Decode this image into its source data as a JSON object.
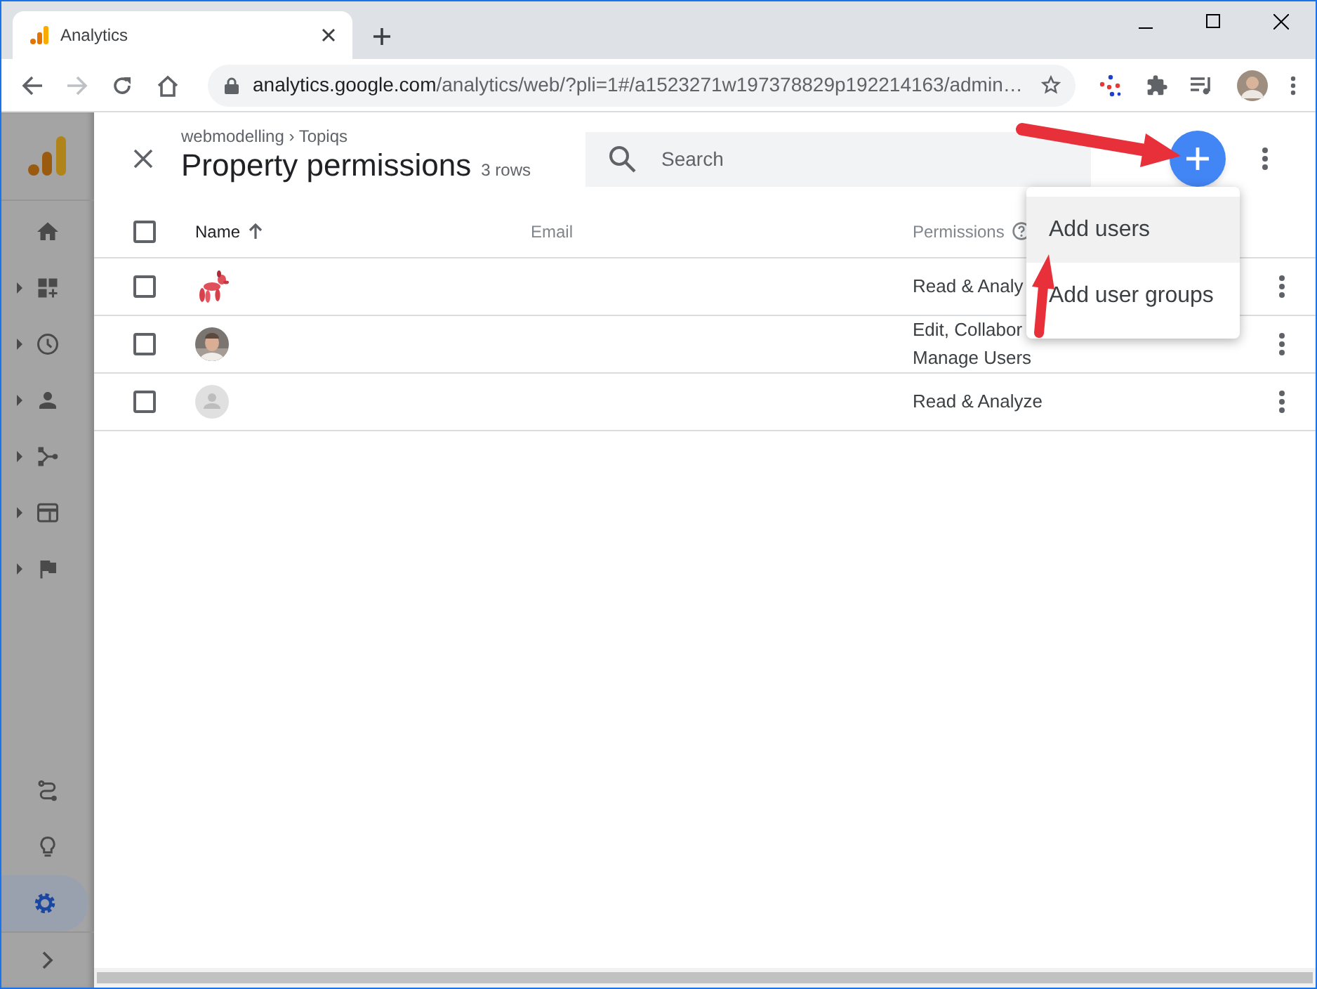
{
  "browser": {
    "tab": {
      "title": "Analytics"
    },
    "address": {
      "host": "analytics.google.com",
      "path": "/analytics/web/?pli=1#/a1523271w197378829p192214163/admin…"
    }
  },
  "sidebar": {
    "items": [
      {
        "expandable": false,
        "selected": false
      },
      {
        "expandable": true,
        "selected": false
      },
      {
        "expandable": true,
        "selected": false
      },
      {
        "expandable": true,
        "selected": false
      },
      {
        "expandable": true,
        "selected": false
      },
      {
        "expandable": true,
        "selected": false
      },
      {
        "expandable": true,
        "selected": false
      }
    ],
    "bottom_items": [
      {
        "selected": false
      },
      {
        "selected": false
      },
      {
        "selected": true
      }
    ]
  },
  "panel": {
    "breadcrumb": "webmodelling › Topiqs",
    "title": "Property permissions",
    "count": "3 rows",
    "search": {
      "placeholder": "Search"
    }
  },
  "table": {
    "all_checked": false,
    "columns": [
      {
        "label": "Name",
        "sorted": true,
        "help": false
      },
      {
        "label": "Email",
        "sorted": false,
        "help": false
      },
      {
        "label": "Permissions",
        "sorted": false,
        "help": true
      }
    ],
    "rows": [
      {
        "checked": false,
        "kind": "picture",
        "permissions": [
          "Read & Analy"
        ]
      },
      {
        "checked": false,
        "permissions": [
          "Edit, Collabor",
          "Manage Users"
        ]
      },
      {
        "checked": false,
        "kind": "default",
        "permissions": [
          "Read & Analyze"
        ]
      }
    ]
  },
  "menu": {
    "items": [
      {
        "label": "Add users",
        "selected": true
      },
      {
        "label": "Add user groups",
        "selected": false
      }
    ]
  }
}
